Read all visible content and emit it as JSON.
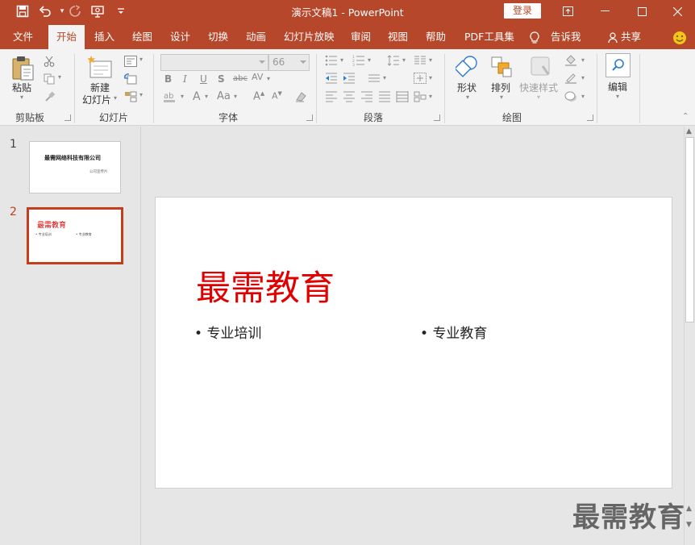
{
  "window": {
    "title": "演示文稿1  -  PowerPoint",
    "login_label": "登录"
  },
  "quick_access": {
    "icons": [
      "save-icon",
      "undo-icon",
      "redo-icon",
      "start-from-beginning-icon",
      "customize-icon"
    ]
  },
  "menu": {
    "tabs": [
      "文件",
      "开始",
      "插入",
      "绘图",
      "设计",
      "切换",
      "动画",
      "幻灯片放映",
      "审阅",
      "视图",
      "帮助",
      "PDF工具集"
    ],
    "active": "开始",
    "tell_me": "告诉我",
    "share": "共享"
  },
  "ribbon": {
    "clipboard": {
      "paste": "粘贴",
      "label": "剪贴板"
    },
    "slides": {
      "new_slide_line1": "新建",
      "new_slide_line2": "幻灯片",
      "label": "幻灯片"
    },
    "font": {
      "size": "66",
      "label": "字体"
    },
    "paragraph": {
      "label": "段落"
    },
    "drawing": {
      "shapes": "形状",
      "arrange": "排列",
      "quick_styles": "快速样式",
      "label": "绘图"
    },
    "editing": {
      "label": "编辑"
    }
  },
  "slides_panel": {
    "slides": [
      {
        "number": "1",
        "title": "最需网络科技有限公司",
        "subtitle": "公司宣传片"
      },
      {
        "number": "2",
        "title": "最需教育",
        "bullet1": "专业培训",
        "bullet2": "专业教育"
      }
    ],
    "active": "2"
  },
  "slide": {
    "title": "最需教育",
    "bullets": [
      "专业培训",
      "专业教育"
    ]
  },
  "watermark": "最需教育",
  "colors": {
    "accent": "#b7472a",
    "title_red": "#e00000",
    "active_border": "#c43e1c"
  }
}
